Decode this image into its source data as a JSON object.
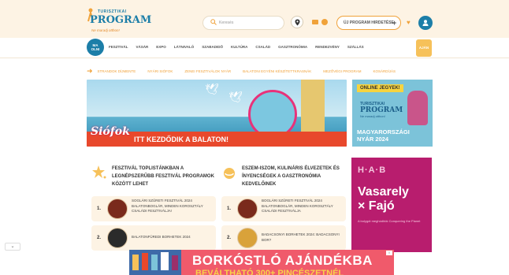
{
  "logo": {
    "top": "TURISZTIKAI",
    "main": "PROGRAM",
    "tagline": "Ne maradj otthon!"
  },
  "search": {
    "placeholder": "Keresés"
  },
  "header": {
    "new_program_label": "ÚJ PROGRAM HIRDETÉSE",
    "plus": "+"
  },
  "nav": {
    "badge": "MA\nOLNI",
    "items": [
      "FESZTIVÁL",
      "VÁSÁR",
      "EXPO",
      "LÁTNIVALÓ",
      "SZABADIDŐ",
      "KULTÚRA",
      "CSALÁD",
      "GASZTRONÓMIA",
      "RENDEZVÉNY",
      "SZÁLLÁS"
    ],
    "right": "AJÁN"
  },
  "categories": [
    "STRANDOK DÍJMENTE",
    "NYÁRI SIÓFOK",
    "ZENEI FESZTIVÁLOK NYÁR",
    "BALATONI EGYÉNI KÉSZÍTETTKRASNÁK",
    "MEZŐVÉGI PROGRAM",
    "KOSÁRDÍJÁS"
  ],
  "banner": {
    "siofok": "Siófok",
    "text": "ITT KEZDŐDIK A BALATON!"
  },
  "side_ad": {
    "online": "ONLINE JEGYEK!",
    "logo_top": "TURISZTIKAI",
    "logo_main": "PROGRAM",
    "logo_tag": "Ne maradj otthon!",
    "title_line1": "MAGYARORSZÁGI",
    "title_line2": "NYÁR 2024"
  },
  "card_left": {
    "title": "FESZTIVÁL TOPLISTÁNKBAN A LEGNÉPSZERŰBB FESZTIVÁL PROGRAMOK KÖZÖTT LEHET",
    "items": [
      {
        "num": "1.",
        "text": "SOGLÁRI SZÜRETI FESZTIVÁL 2024 BALATONBOGLÁR, MINDEN KOROSZTÁLY CSALÁDI FESZTIVÁLJA!"
      },
      {
        "num": "2.",
        "text": "BALATONFÜREDI BORHETEK 2024"
      }
    ]
  },
  "card_right": {
    "title": "ESZEM-ISZOM, KULINÁRIS ÉLVEZETEK ÉS ÍNYENCSÉGEK A GASZTRONÓMIA KEDVELŐINEK",
    "items": [
      {
        "num": "1.",
        "text": "BOGLÁRI SZÜRETI FESZTIVÁL 2024 BALATONBOGLÁR, MINDEN KOROSZTÁLY CSALÁDI FESZTIVÁLJA"
      },
      {
        "num": "2.",
        "text": "BADACSONYI BORHETEK 2024: BADACSONYI BOR?"
      }
    ]
  },
  "right_ad": {
    "logo": "H·A·B",
    "title_line1": "Vasarely",
    "title_line2": "× Fajó",
    "sub": "A bolygót meghódítók Conquering the Planet"
  },
  "bottom_ad": {
    "title": "BORKÓSTLÓ AJÁNDÉKBA",
    "sub": "BEVÁLTHATÓ 300+ PINCÉSZETNÉL",
    "close": "X"
  },
  "collapse": "⌄"
}
